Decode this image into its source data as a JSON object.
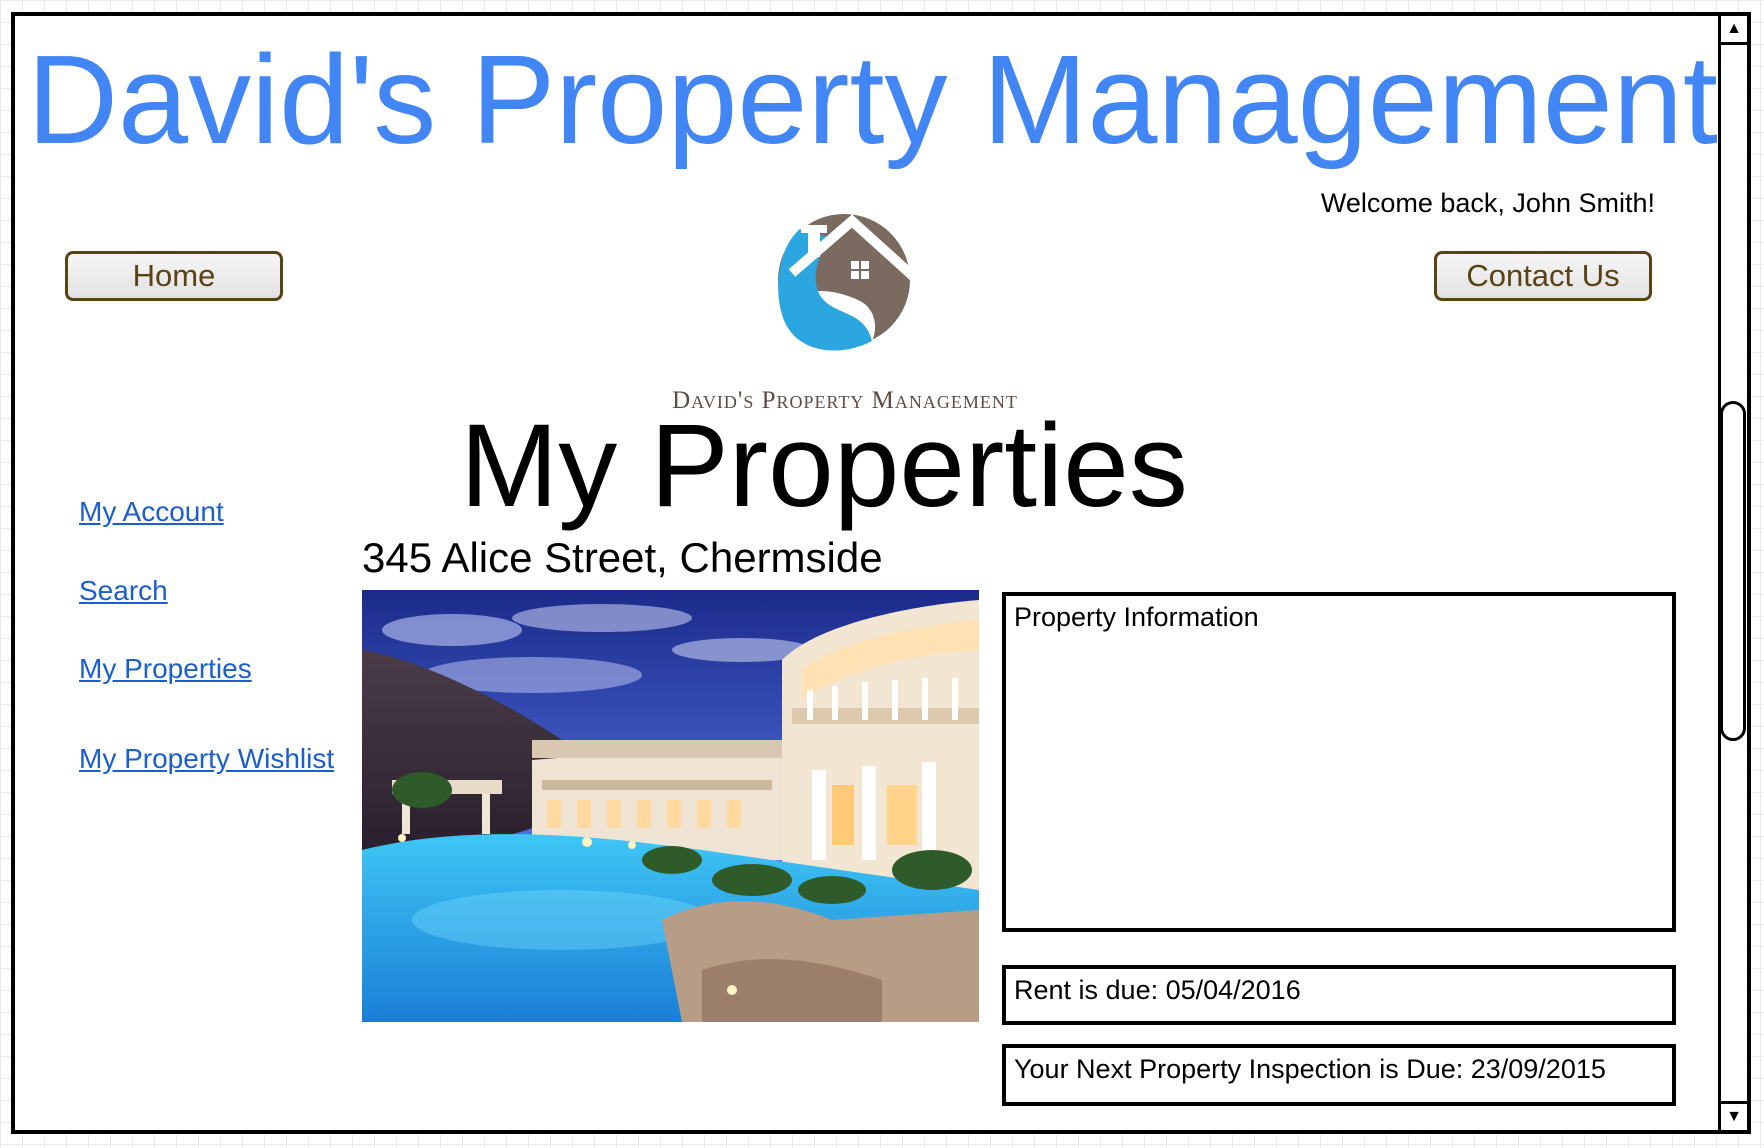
{
  "header": {
    "site_title": "David's Property Management",
    "welcome_text": "Welcome back, John Smith!",
    "home_label": "Home",
    "contact_label": "Contact Us"
  },
  "logo": {
    "text": "David's Property Management",
    "colors": {
      "brown": "#7a6a5f",
      "blue": "#2ba6e1"
    }
  },
  "main": {
    "heading": "My Properties",
    "address": "345 Alice Street, Chermside"
  },
  "sidebar": {
    "items": [
      {
        "label": "My Account"
      },
      {
        "label": "Search"
      },
      {
        "label": "My Properties"
      },
      {
        "label": "My Property Wishlist"
      }
    ]
  },
  "property": {
    "info_label": "Property Information",
    "rent_text": "Rent is due: 05/04/2016",
    "inspection_text": "Your Next Property Inspection is Due: 23/09/2015"
  },
  "colors": {
    "title_blue": "#4285f4",
    "link_blue": "#1a5fd0",
    "button_border": "#5a4215"
  }
}
